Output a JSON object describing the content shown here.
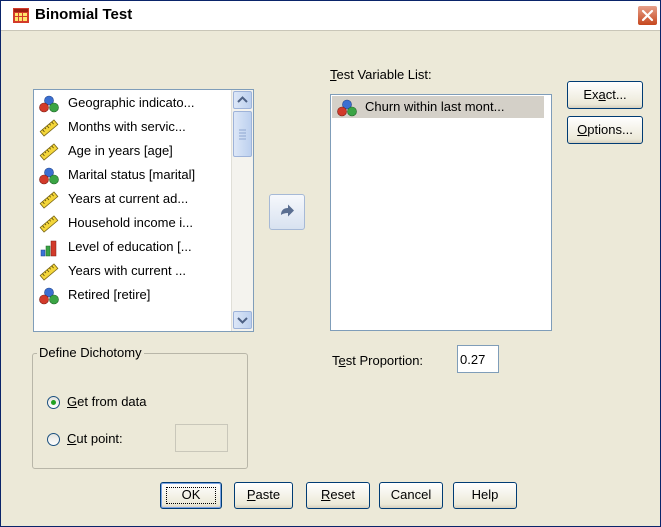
{
  "window": {
    "title": "Binomial Test"
  },
  "source_variables": {
    "items": [
      {
        "label": "Geographic indicato...",
        "icon": "nominal-icon"
      },
      {
        "label": "Months with servic...",
        "icon": "scale-ruler-icon"
      },
      {
        "label": "Age in years [age]",
        "icon": "scale-ruler-icon"
      },
      {
        "label": "Marital status [marital]",
        "icon": "nominal-icon"
      },
      {
        "label": "Years at current ad...",
        "icon": "scale-ruler-icon"
      },
      {
        "label": "Household income i...",
        "icon": "scale-ruler-icon"
      },
      {
        "label": "Level of education [...",
        "icon": "ordinal-icon"
      },
      {
        "label": "Years with current ...",
        "icon": "scale-ruler-icon"
      },
      {
        "label": "Retired [retire]",
        "icon": "nominal-icon"
      }
    ]
  },
  "test_variable_list": {
    "label_pre": "",
    "label_mnemonic": "T",
    "label_post": "est Variable List:",
    "items": [
      {
        "label": "Churn within last mont...",
        "icon": "nominal-icon"
      }
    ]
  },
  "side_buttons": {
    "exact": {
      "pre": "Ex",
      "mn": "a",
      "post": "ct..."
    },
    "options": {
      "pre": "",
      "mn": "O",
      "post": "ptions..."
    }
  },
  "define_dichotomy": {
    "title": "Define Dichotomy",
    "get_from_data": {
      "pre": "",
      "mn": "G",
      "post": "et from data",
      "selected": true
    },
    "cut_point": {
      "pre": "",
      "mn": "C",
      "post": "ut point:",
      "selected": false,
      "value": ""
    }
  },
  "test_proportion": {
    "pre": "T",
    "mn": "e",
    "post": "st Proportion:",
    "value": "0.27"
  },
  "bottom_buttons": {
    "ok": "OK",
    "paste": {
      "pre": "",
      "mn": "P",
      "post": "aste"
    },
    "reset": {
      "pre": "",
      "mn": "R",
      "post": "eset"
    },
    "cancel": "Cancel",
    "help": "Help"
  },
  "colors": {
    "dialog_background": "#ece9d8",
    "selection_background": "#d4d0c8",
    "close_button": "#c6471e",
    "radio_dot": "#21a121"
  }
}
